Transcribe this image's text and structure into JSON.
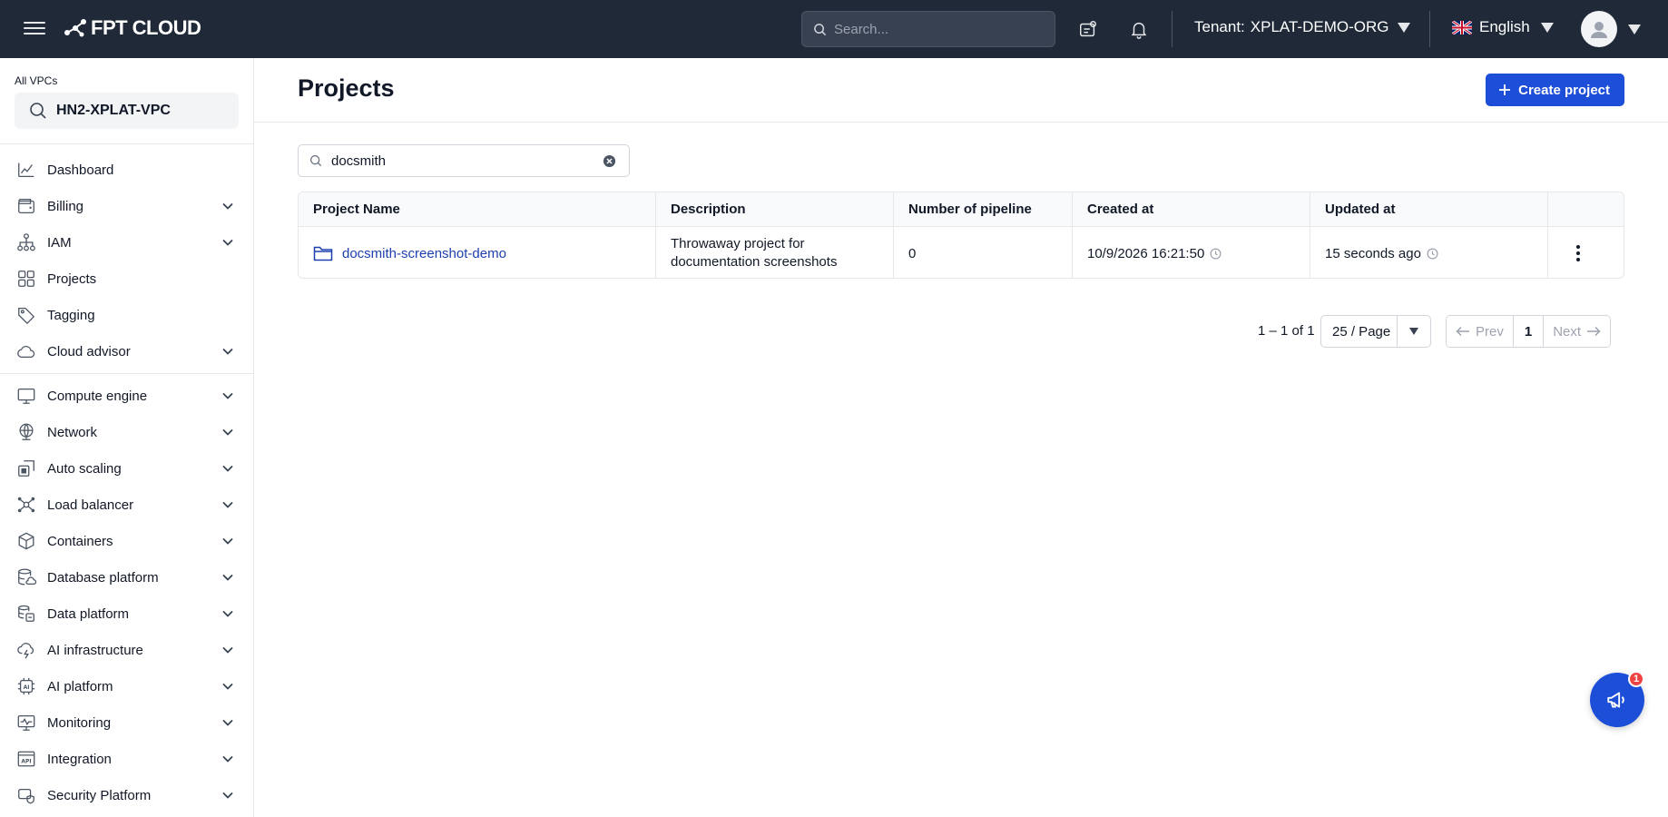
{
  "topbar": {
    "logo_text": "FPT CLOUD",
    "search_placeholder": "Search...",
    "tenant_label": "Tenant:",
    "tenant_value": "XPLAT-DEMO-ORG",
    "language": "English"
  },
  "sidebar": {
    "vpc_label": "All VPCs",
    "vpc_value": "HN2-XPLAT-VPC",
    "items": [
      {
        "label": "Dashboard",
        "icon": "chart-line-icon",
        "expandable": false
      },
      {
        "label": "Billing",
        "icon": "wallet-icon",
        "expandable": true
      },
      {
        "label": "IAM",
        "icon": "hierarchy-icon",
        "expandable": true
      },
      {
        "label": "Projects",
        "icon": "grid-icon",
        "expandable": false
      },
      {
        "label": "Tagging",
        "icon": "tag-icon",
        "expandable": false
      },
      {
        "label": "Cloud advisor",
        "icon": "cloud-icon",
        "expandable": true
      },
      {
        "label": "Compute engine",
        "icon": "monitor-icon",
        "expandable": true
      },
      {
        "label": "Network",
        "icon": "globe-icon",
        "expandable": true
      },
      {
        "label": "Auto scaling",
        "icon": "scaling-icon",
        "expandable": true
      },
      {
        "label": "Load balancer",
        "icon": "nodes-icon",
        "expandable": true
      },
      {
        "label": "Containers",
        "icon": "cube-icon",
        "expandable": true
      },
      {
        "label": "Database platform",
        "icon": "database-icon",
        "expandable": true
      },
      {
        "label": "Data platform",
        "icon": "data-stack-icon",
        "expandable": true
      },
      {
        "label": "AI infrastructure",
        "icon": "cloud-bolt-icon",
        "expandable": true
      },
      {
        "label": "AI platform",
        "icon": "chip-icon",
        "expandable": true
      },
      {
        "label": "Monitoring",
        "icon": "monitor-pulse-icon",
        "expandable": true
      },
      {
        "label": "Integration",
        "icon": "api-icon",
        "expandable": true
      },
      {
        "label": "Security Platform",
        "icon": "shield-lock-icon",
        "expandable": true
      }
    ]
  },
  "main": {
    "title": "Projects",
    "create_label": "Create project",
    "filter_value": "docsmith",
    "table": {
      "headers": [
        "Project Name",
        "Description",
        "Number of pipeline",
        "Created at",
        "Updated at"
      ],
      "rows": [
        {
          "name": "docsmith-screenshot-demo",
          "description_line1": "Throwaway project for",
          "description_line2": "documentation screenshots",
          "pipelines": "0",
          "created_at": "10/9/2026 16:21:50",
          "updated_at": "15 seconds ago"
        }
      ]
    },
    "pagination": {
      "info": "1 – 1 of 1",
      "page_size": "25 / Page",
      "prev": "Prev",
      "current": "1",
      "next": "Next"
    }
  },
  "fab": {
    "badge": "1"
  },
  "colors": {
    "topbar_bg": "#1f2937",
    "primary": "#1d4ed8",
    "link": "#1e40af",
    "badge": "#ef4444"
  }
}
